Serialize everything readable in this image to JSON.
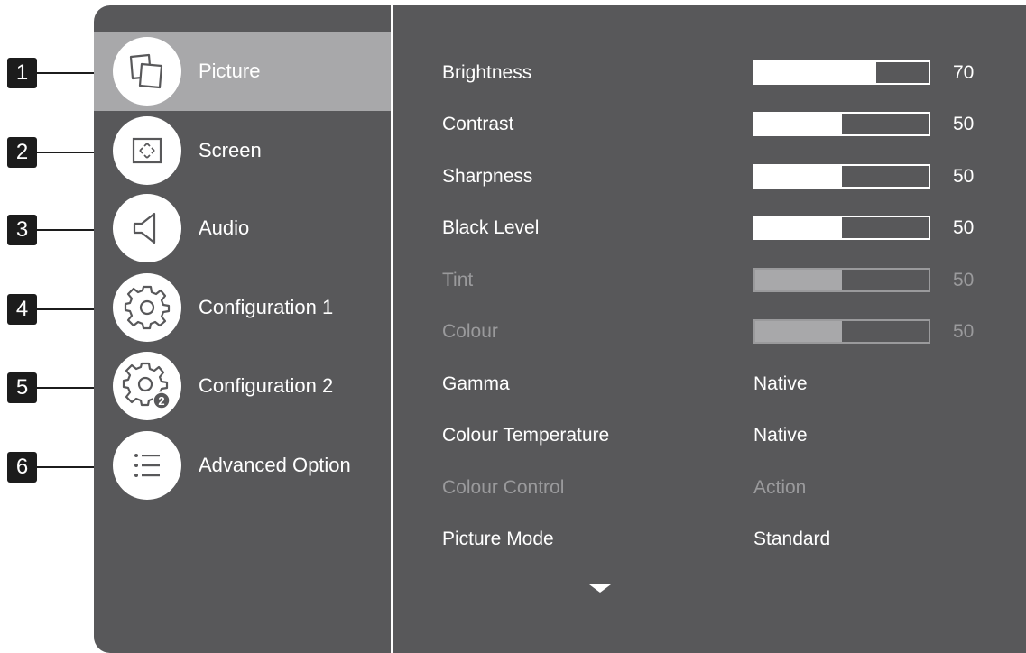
{
  "callouts": [
    "1",
    "2",
    "3",
    "4",
    "5",
    "6"
  ],
  "menu": {
    "items": [
      {
        "label": "Picture",
        "icon": "picture-icon",
        "selected": true
      },
      {
        "label": "Screen",
        "icon": "screen-icon"
      },
      {
        "label": "Audio",
        "icon": "speaker-icon"
      },
      {
        "label": "Configuration 1",
        "icon": "gear-icon"
      },
      {
        "label": "Configuration 2",
        "icon": "gear-2-icon",
        "badge": "2"
      },
      {
        "label": "Advanced Option",
        "icon": "list-icon"
      }
    ]
  },
  "settings": {
    "sliders": [
      {
        "label": "Brightness",
        "value": "70",
        "level": 0.7,
        "enabled": true
      },
      {
        "label": "Contrast",
        "value": "50",
        "level": 0.5,
        "enabled": true
      },
      {
        "label": "Sharpness",
        "value": "50",
        "level": 0.5,
        "enabled": true
      },
      {
        "label": "Black Level",
        "value": "50",
        "level": 0.5,
        "enabled": true
      },
      {
        "label": "Tint",
        "value": "50",
        "level": 0.5,
        "enabled": false
      },
      {
        "label": "Colour",
        "value": "50",
        "level": 0.5,
        "enabled": false
      }
    ],
    "options": [
      {
        "label": "Gamma",
        "value": "Native",
        "enabled": true
      },
      {
        "label": "Colour Temperature",
        "value": "Native",
        "enabled": true
      },
      {
        "label": "Colour Control",
        "value": "Action",
        "enabled": false
      },
      {
        "label": "Picture Mode",
        "value": "Standard",
        "enabled": true
      }
    ]
  },
  "colors": {
    "panel": "#58585a",
    "selected": "#a8a8aa",
    "text": "#ffffff",
    "disabled": "#9a9a9c",
    "callout": "#1c1c1c"
  }
}
